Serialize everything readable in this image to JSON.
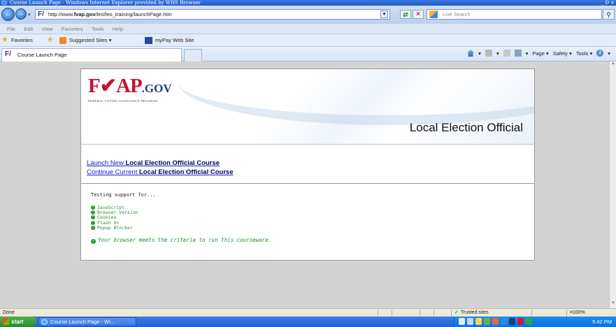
{
  "window": {
    "title": "Course Launch Page - Windows Internet Explorer provided by WHS Browser",
    "controls": [
      "_",
      "Ɖ",
      "×"
    ]
  },
  "address": {
    "url_prefix": "http://www.",
    "url_domain": "fvap.gov",
    "url_path": "/leo/leo_training/launchPage.htm",
    "search_placeholder": "Live Search"
  },
  "menu": [
    "File",
    "Edit",
    "View",
    "Favorites",
    "Tools",
    "Help"
  ],
  "favorites_bar": {
    "favorites_label": "Favorites",
    "suggested_sites": "Suggested Sites ▾",
    "mypay": "myPay Web Site"
  },
  "tab": {
    "label": "Course Launch Page"
  },
  "commands": {
    "page": "Page ▾",
    "safety": "Safety ▾",
    "tools": "Tools ▾"
  },
  "page": {
    "logo": {
      "fv": "F✔AP",
      "gov": ".GOV",
      "tagline": "FEDERAL VOTING ASSISTANCE PROGRAM"
    },
    "heading": "Local Election Official",
    "links": [
      {
        "prefix": "Launch New ",
        "strong": "Local Election Official Course"
      },
      {
        "prefix": "Continue Current ",
        "strong": "Local Election Official Course"
      }
    ],
    "testing_intro": "Testing support for...",
    "checks": [
      "JavaScript",
      "Browser Version",
      "Cookies",
      "Flash 9+",
      "Popup Blocker"
    ],
    "result": "Your browser meets the criteria to run this courseware."
  },
  "status": {
    "done": "Done",
    "trusted": "Trusted sites",
    "zoom": "¤100%"
  },
  "taskbar": {
    "start": "start",
    "task": "Course Launch Page - Wi...",
    "clock": "5:42 PM"
  },
  "colors": {
    "fvap_red": "#c8102e",
    "fvap_blue": "#1f3c8a",
    "check_green": "#2a8a2a",
    "link_blue": "#1a1acc"
  }
}
